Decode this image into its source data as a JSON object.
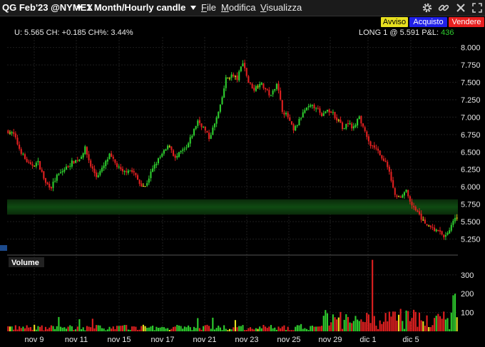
{
  "toolbar": {
    "symbol": "QG Feb'23 @NYMEX",
    "period": "1 Month/Hourly candle",
    "menu": [
      "File",
      "Modifica",
      "Visualizza"
    ],
    "buttons": {
      "alert": "Avviso",
      "buy": "Acquisto",
      "sell": "Vendere"
    }
  },
  "info": {
    "quote": "U: 5.565 CH: +0.185 CH%: 3.44%",
    "position": "LONG 1 @ 5.591 P&L: ",
    "pnl": "436"
  },
  "volume_label": "Volume",
  "colors": {
    "up": "#2ecc2e",
    "down": "#e02020",
    "neutral": "#e8e020",
    "alert": "#e8e020",
    "buy": "#2020e8",
    "sell": "#e82020"
  },
  "chart_data": [
    {
      "type": "candlestick",
      "title": "",
      "ylim": [
        5.05,
        8.15
      ],
      "yticks": [
        "8.000",
        "7.750",
        "7.500",
        "7.250",
        "7.000",
        "6.750",
        "6.500",
        "6.250",
        "6.000",
        "5.750",
        "5.500",
        "5.250"
      ],
      "xticks": [
        "nov 9",
        "nov 11",
        "nov 15",
        "nov 17",
        "nov 21",
        "nov 23",
        "nov 25",
        "nov 29",
        "dic 1",
        "dic 5"
      ],
      "position_band": [
        5.6,
        5.82
      ],
      "close_path": [
        [
          0,
          6.8
        ],
        [
          3,
          6.75
        ],
        [
          6,
          6.55
        ],
        [
          9,
          6.4
        ],
        [
          12,
          6.3
        ],
        [
          16,
          6.35
        ],
        [
          20,
          6.05
        ],
        [
          23,
          6.0
        ],
        [
          26,
          6.15
        ],
        [
          30,
          6.25
        ],
        [
          34,
          6.35
        ],
        [
          38,
          6.4
        ],
        [
          41,
          6.55
        ],
        [
          44,
          6.3
        ],
        [
          47,
          6.15
        ],
        [
          50,
          6.25
        ],
        [
          54,
          6.45
        ],
        [
          58,
          6.3
        ],
        [
          61,
          6.2
        ],
        [
          64,
          6.25
        ],
        [
          67,
          6.2
        ],
        [
          70,
          6.05
        ],
        [
          73,
          6.0
        ],
        [
          76,
          6.2
        ],
        [
          79,
          6.35
        ],
        [
          83,
          6.5
        ],
        [
          86,
          6.6
        ],
        [
          89,
          6.4
        ],
        [
          92,
          6.5
        ],
        [
          95,
          6.55
        ],
        [
          98,
          6.75
        ],
        [
          101,
          6.95
        ],
        [
          104,
          6.85
        ],
        [
          107,
          6.7
        ],
        [
          110,
          6.9
        ],
        [
          113,
          7.15
        ],
        [
          116,
          7.55
        ],
        [
          119,
          7.6
        ],
        [
          122,
          7.55
        ],
        [
          125,
          7.8
        ],
        [
          128,
          7.5
        ],
        [
          131,
          7.4
        ],
        [
          134,
          7.5
        ],
        [
          137,
          7.4
        ],
        [
          140,
          7.3
        ],
        [
          143,
          7.5
        ],
        [
          146,
          7.1
        ],
        [
          149,
          7.0
        ],
        [
          152,
          6.8
        ],
        [
          155,
          6.95
        ],
        [
          158,
          7.1
        ],
        [
          161,
          7.15
        ],
        [
          164,
          7.15
        ],
        [
          167,
          7.0
        ],
        [
          170,
          7.1
        ],
        [
          173,
          7.05
        ],
        [
          176,
          6.95
        ],
        [
          178,
          6.85
        ],
        [
          181,
          6.9
        ],
        [
          184,
          6.85
        ],
        [
          187,
          7.0
        ],
        [
          190,
          6.8
        ],
        [
          193,
          6.6
        ],
        [
          196,
          6.55
        ],
        [
          199,
          6.4
        ],
        [
          202,
          6.3
        ],
        [
          204,
          6.1
        ],
        [
          206,
          5.9
        ],
        [
          209,
          5.85
        ],
        [
          212,
          5.95
        ],
        [
          214,
          5.8
        ],
        [
          217,
          5.65
        ],
        [
          220,
          5.55
        ],
        [
          223,
          5.45
        ],
        [
          226,
          5.4
        ],
        [
          229,
          5.35
        ],
        [
          232,
          5.3
        ],
        [
          235,
          5.38
        ],
        [
          237,
          5.5
        ],
        [
          239,
          5.565
        ]
      ]
    },
    {
      "type": "bar",
      "title": "Volume",
      "ylim": [
        0,
        390
      ],
      "yticks": [
        "300",
        "200",
        "100"
      ],
      "peak_volume": 380
    }
  ]
}
